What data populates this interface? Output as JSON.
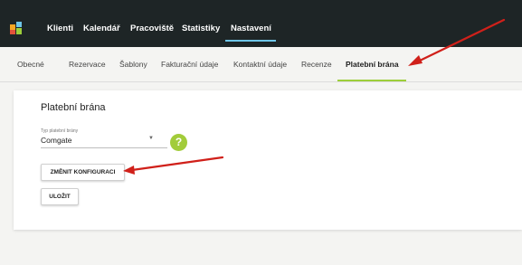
{
  "topnav": {
    "items": [
      "Klienti",
      "Kalendář",
      "Pracoviště",
      "Statistiky",
      "Nastavení"
    ],
    "active": "Nastavení"
  },
  "subnav": {
    "tabs": [
      "Obecné",
      "Rezervace",
      "Šablony",
      "Fakturační údaje",
      "Kontaktní údaje",
      "Recenze",
      "Platební brána"
    ],
    "active": "Platební brána"
  },
  "card": {
    "title": "Platební brána",
    "gateway_label": "Typ platební brány",
    "gateway_value": "Comgate",
    "help_label": "?",
    "change_config_label": "ZMĚNIT KONFIGURACI",
    "save_label": "ULOŽIT"
  },
  "colors": {
    "topbar_bg": "#1e2526",
    "active_nav_underline": "#6ec5e8",
    "active_tab_underline": "#9dce3a",
    "help_button": "#a2cc3a",
    "annotation_arrow": "#d0201a"
  }
}
